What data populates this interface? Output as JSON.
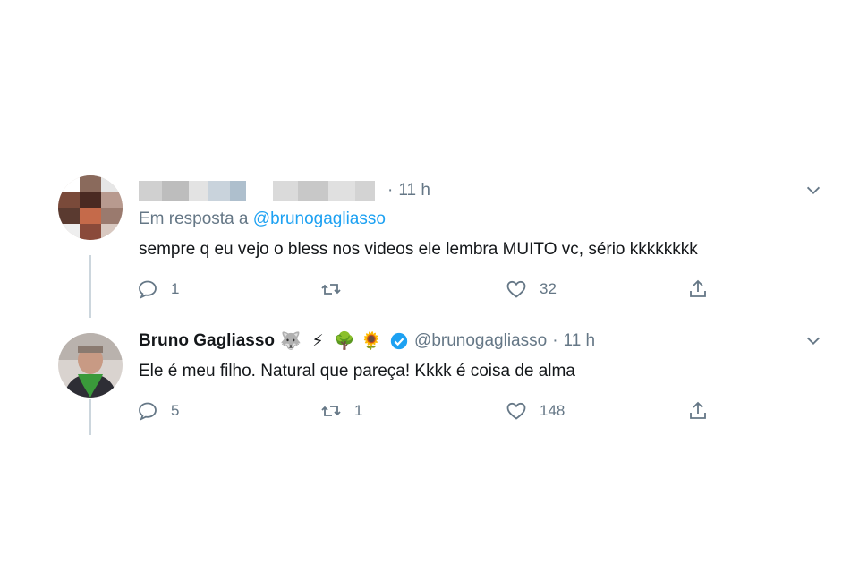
{
  "reply_tweet": {
    "time": "11 h",
    "in_reply_prefix": "Em resposta a",
    "in_reply_handle": "@brunogagliasso",
    "text": "sempre q eu vejo o bless nos videos ele lembra MUITO vc, sério kkkkkkkk",
    "reply_count": "1",
    "retweet_count": "",
    "like_count": "32"
  },
  "main_tweet": {
    "author_name": "Bruno Gagliasso",
    "emojis": [
      "🐺",
      "⚡",
      "🌳",
      "🌻"
    ],
    "handle": "@brunogagliasso",
    "time": "11 h",
    "text": "Ele é meu filho. Natural que pareça! Kkkk é coisa de alma",
    "reply_count": "5",
    "retweet_count": "1",
    "like_count": "148"
  },
  "colors": {
    "accent": "#1da1f2",
    "muted": "#657786",
    "thread_line": "#ccd6dd"
  },
  "icons": [
    "reply-icon",
    "retweet-icon",
    "like-icon",
    "share-icon",
    "chevron-down-icon",
    "verified-badge-icon"
  ]
}
